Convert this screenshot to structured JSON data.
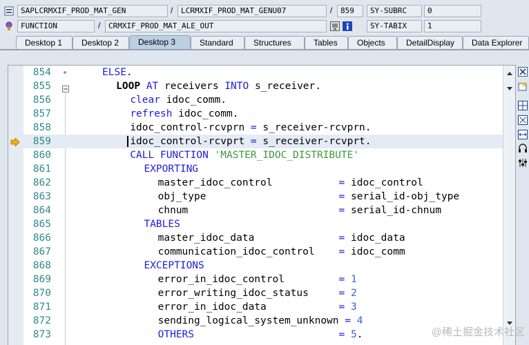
{
  "header": {
    "row1": {
      "program": "SAPLCRMXIF_PROD_MAT_GEN",
      "include": "LCRMXIF_PROD_MAT_GENU07",
      "line_no": "859",
      "var_label": "SY-SUBRC",
      "var_value": "0"
    },
    "row2": {
      "event_type": "FUNCTION",
      "event_name": "CRMXIF_PROD_MAT_ALE_OUT",
      "var_label": "SY-TABIX",
      "var_value": "1"
    },
    "separator": "/"
  },
  "tabs": [
    "Desktop 1",
    "Desktop 2",
    "Desktop 3",
    "Standard",
    "Structures",
    "Tables",
    "Objects",
    "DetailDisplay",
    "Data Explorer"
  ],
  "active_tab": "Desktop 3",
  "code_lines": [
    {
      "num": "854",
      "text": "ELSE."
    },
    {
      "num": "855",
      "text": "LOOP AT receivers INTO s_receiver."
    },
    {
      "num": "856",
      "text": "clear idoc_comm."
    },
    {
      "num": "857",
      "text": "refresh idoc_comm."
    },
    {
      "num": "858",
      "text": "idoc_control-rcvprn = s_receiver-rcvprn."
    },
    {
      "num": "859",
      "text": "idoc_control-rcvprt = s_receiver-rcvprt."
    },
    {
      "num": "860",
      "text": "CALL FUNCTION 'MASTER_IDOC_DISTRIBUTE'"
    },
    {
      "num": "861",
      "text": "EXPORTING"
    },
    {
      "num": "862",
      "text": "master_idoc_control           = idoc_control"
    },
    {
      "num": "863",
      "text": "obj_type                      = serial_id-obj_type"
    },
    {
      "num": "864",
      "text": "chnum                         = serial_id-chnum"
    },
    {
      "num": "865",
      "text": "TABLES"
    },
    {
      "num": "866",
      "text": "master_idoc_data              = idoc_data"
    },
    {
      "num": "867",
      "text": "communication_idoc_control    = idoc_comm"
    },
    {
      "num": "868",
      "text": "EXCEPTIONS"
    },
    {
      "num": "869",
      "text": "error_in_idoc_control         = 1"
    },
    {
      "num": "870",
      "text": "error_writing_idoc_status     = 2"
    },
    {
      "num": "871",
      "text": "error_in_idoc_data            = 3"
    },
    {
      "num": "872",
      "text": "sending_logical_system_unknown = 4"
    },
    {
      "num": "873",
      "text": "OTHERS                        = 5."
    }
  ],
  "current_line": "859",
  "watermark": "@稀土掘金技术社区",
  "colors": {
    "keyword": "#1c1cdd",
    "string": "#3c9a3c",
    "number": "#3c5fe0",
    "line_number": "#2f8a8a",
    "current_line_bg": "#e4ebf5"
  }
}
